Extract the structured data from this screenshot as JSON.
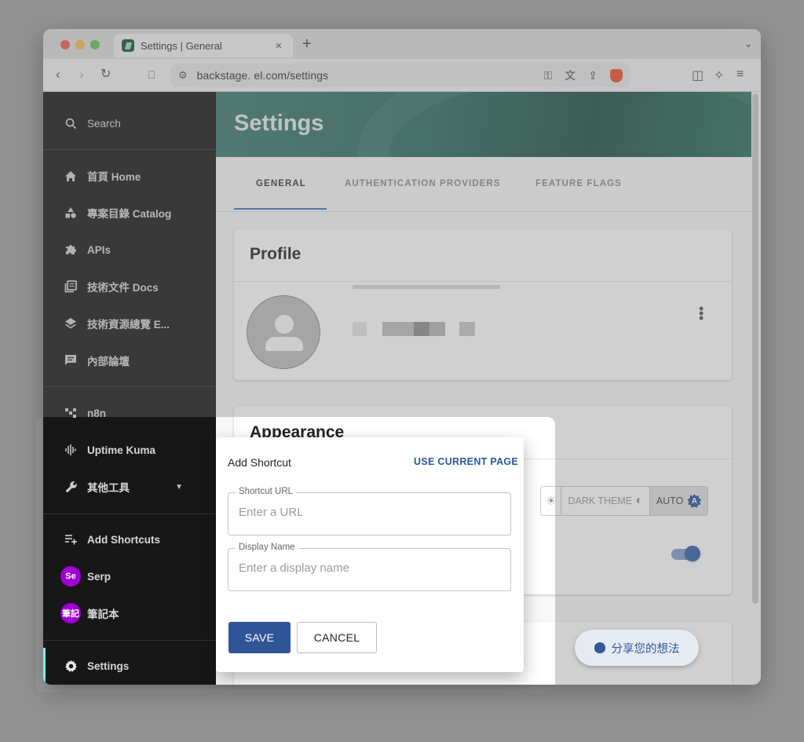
{
  "browser": {
    "tab_title": "Settings | General",
    "tab_close": "×",
    "new_tab": "+",
    "url": "backstage.          el.com/settings"
  },
  "sidebar": {
    "search": "Search",
    "items": [
      {
        "label": "首頁 Home",
        "icon": "home-icon"
      },
      {
        "label": "專案目錄 Catalog",
        "icon": "category-icon"
      },
      {
        "label": "APIs",
        "icon": "extension-icon"
      },
      {
        "label": "技術文件 Docs",
        "icon": "library-books-icon"
      },
      {
        "label": "技術資源總覽 E...",
        "icon": "layers-icon"
      },
      {
        "label": "內部論壇",
        "icon": "forum-icon"
      }
    ],
    "tools": [
      {
        "label": "n8n",
        "icon": "workflow-icon"
      },
      {
        "label": "Uptime Kuma",
        "icon": "activity-icon"
      },
      {
        "label": "其他工具",
        "icon": "wrench-icon"
      }
    ],
    "add_shortcuts": "Add Shortcuts",
    "shortcuts": [
      {
        "avatar": "Se",
        "label": "Serp"
      },
      {
        "avatar": "筆記",
        "label": "筆記本"
      }
    ],
    "settings": "Settings",
    "accent_color": "#7df3e1"
  },
  "main": {
    "title": "Settings",
    "tabs": [
      "GENERAL",
      "AUTHENTICATION PROVIDERS",
      "FEATURE FLAGS"
    ],
    "profile_title": "Profile",
    "appearance_title": "Appearance",
    "theme_dark": "DARK THEME",
    "theme_auto": "AUTO",
    "feedback": "分享您的想法",
    "toggle_on": true
  },
  "dialog": {
    "title": "Add Shortcut",
    "use_current_page": "USE CURRENT PAGE",
    "url_label": "Shortcut URL",
    "url_placeholder": "Enter a URL",
    "name_label": "Display Name",
    "name_placeholder": "Enter a display name",
    "save": "SAVE",
    "cancel": "CANCEL",
    "primary_color": "#2f5597"
  }
}
